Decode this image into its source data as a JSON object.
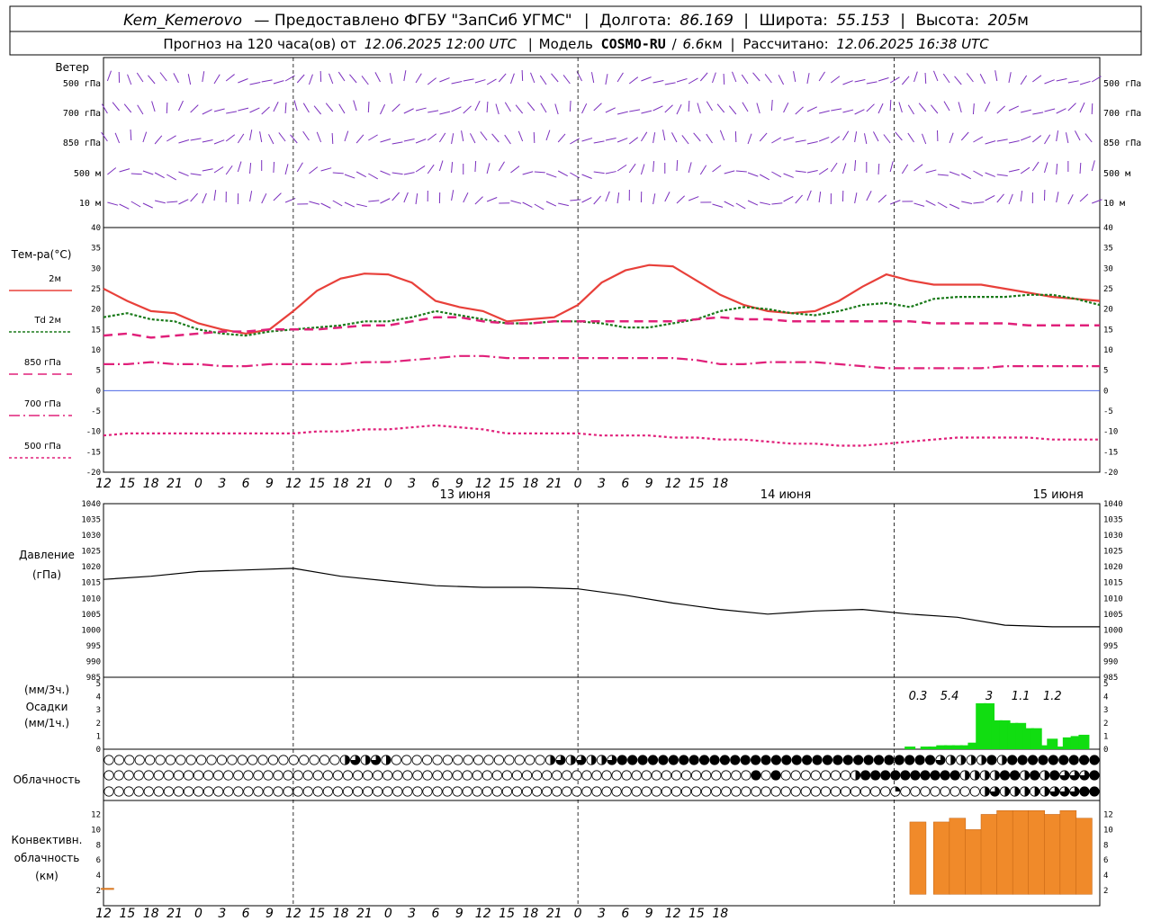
{
  "header": {
    "station": "Kem_Kemerovo",
    "provider": "— Предоставлено ФГБУ \"ЗапСиб УГМС\"",
    "lon_label": "Долгота:",
    "lon_value": "86.169",
    "lat_label": "Широта:",
    "lat_value": "55.153",
    "alt_label": "Высота:",
    "alt_value": "205",
    "alt_unit": "м",
    "forecast_label": "Прогноз на 120 часа(ов) от",
    "forecast_start": "12.06.2025 12:00 UTC",
    "model_label": "Модель",
    "model_name": "COSMO-RU",
    "model_res": "6.6",
    "model_res_unit": "км",
    "calc_label": "Рассчитано:",
    "calc_time": "12.06.2025 16:38 UTC"
  },
  "colors": {
    "wind": "#7b2fbe",
    "t2m": "#e8403a",
    "td2m": "#1a7a1a",
    "t850": "#e0207a",
    "zero_line": "#3050e0",
    "precip": "#11dd11",
    "convective": "#f08a2a"
  },
  "wind_panel": {
    "title": "Ветер",
    "levels": [
      "500 гПа",
      "700 гПа",
      "850 гПа",
      "500 м",
      "10  м"
    ]
  },
  "temp_panel": {
    "title": "Тем-ра(°C)",
    "legend": [
      {
        "label": "2м",
        "style": "solid"
      },
      {
        "label": "Td  2м",
        "style": "dotted"
      },
      {
        "label": "850 гПа",
        "style": "long-dash"
      },
      {
        "label": "700 гПа",
        "style": "dash-dot"
      },
      {
        "label": "500 гПа",
        "style": "dashed"
      }
    ],
    "yticks": [
      40,
      35,
      30,
      25,
      20,
      15,
      10,
      5,
      0,
      -5,
      -10,
      -15,
      -20
    ]
  },
  "time_axis": {
    "hours": [
      "12",
      "15",
      "18",
      "21",
      "0",
      "3",
      "6",
      "9",
      "12",
      "15",
      "18",
      "21",
      "0",
      "3",
      "6",
      "9",
      "12",
      "15",
      "18",
      "21",
      "0",
      "3",
      "6",
      "9",
      "12",
      "15",
      "18"
    ],
    "days": [
      "13 июня",
      "14 июня",
      "15 июня"
    ]
  },
  "pressure_panel": {
    "title": "Давление",
    "unit": "(гПа)",
    "yticks": [
      1040,
      1035,
      1030,
      1025,
      1020,
      1015,
      1010,
      1005,
      1000,
      995,
      990,
      985
    ]
  },
  "precip_panel": {
    "unit3": "(мм/3ч.)",
    "title": "Осадки",
    "unit1": "(мм/1ч.)",
    "yticks": [
      5,
      4,
      3,
      2,
      1,
      0
    ],
    "totals": [
      "0.3",
      "5.4",
      "3",
      "1.1",
      "1.2"
    ]
  },
  "cloud_panel": {
    "title": "Облачность"
  },
  "conv_panel": {
    "title1": "Конвективн.",
    "title2": "облачность",
    "unit": "(км)",
    "yticks": [
      12,
      10,
      8,
      6,
      4,
      2
    ]
  },
  "chart_data": [
    {
      "type": "line",
      "panel": "temperature",
      "ylim": [
        -20,
        40
      ],
      "x_hours": [
        0,
        3,
        6,
        9,
        12,
        15,
        18,
        21,
        24,
        27,
        30,
        33,
        36,
        39,
        42,
        45,
        48,
        51,
        54,
        57,
        60,
        63,
        66,
        69,
        72,
        75,
        78,
        81,
        84,
        87,
        90,
        93,
        96,
        99,
        102,
        105,
        108,
        111,
        114,
        117,
        120,
        123,
        126
      ],
      "series": [
        {
          "name": "2м",
          "values": [
            25,
            22,
            19.5,
            19,
            16.5,
            15,
            14,
            15,
            19.5,
            24.5,
            27.5,
            28.7,
            28.5,
            26.5,
            22,
            20.5,
            19.5,
            17,
            17.5,
            18,
            21,
            26.5,
            29.5,
            30.8,
            30.5,
            27,
            23.5,
            21,
            19.5,
            19,
            19.5,
            22,
            25.5,
            28.5,
            27,
            26,
            26,
            26,
            25,
            24,
            23,
            22.5,
            22
          ]
        },
        {
          "name": "Td  2м",
          "values": [
            18,
            19,
            17.5,
            17,
            15,
            14,
            13.5,
            14.5,
            15,
            15.5,
            16,
            17,
            17,
            18,
            19.5,
            18.5,
            17.5,
            16.5,
            16.5,
            17,
            17,
            16.5,
            15.5,
            15.5,
            16.5,
            17.5,
            19.5,
            20.5,
            20,
            19,
            18.5,
            19.5,
            21,
            21.5,
            20.5,
            22.5,
            23,
            23,
            23,
            23.5,
            23.5,
            22.5,
            21
          ]
        },
        {
          "name": "850 гПа",
          "values": [
            13.5,
            14,
            13,
            13.5,
            14,
            14.5,
            14.5,
            15,
            15,
            15,
            15.5,
            16,
            16,
            17,
            18,
            18,
            17,
            16.5,
            16.5,
            17,
            17,
            17,
            17,
            17,
            17,
            17.5,
            18,
            17.5,
            17.5,
            17,
            17,
            17,
            17,
            17,
            17,
            16.5,
            16.5,
            16.5,
            16.5,
            16,
            16,
            16,
            16
          ]
        },
        {
          "name": "700 гПа",
          "values": [
            6.5,
            6.5,
            7,
            6.5,
            6.5,
            6,
            6,
            6.5,
            6.5,
            6.5,
            6.5,
            7,
            7,
            7.5,
            8,
            8.5,
            8.5,
            8,
            8,
            8,
            8,
            8,
            8,
            8,
            8,
            7.5,
            6.5,
            6.5,
            7,
            7,
            7,
            6.5,
            6,
            5.5,
            5.5,
            5.5,
            5.5,
            5.5,
            6,
            6,
            6,
            6,
            6
          ]
        },
        {
          "name": "500 гПа",
          "values": [
            -11,
            -10.5,
            -10.5,
            -10.5,
            -10.5,
            -10.5,
            -10.5,
            -10.5,
            -10.5,
            -10,
            -10,
            -9.5,
            -9.5,
            -9,
            -8.5,
            -9,
            -9.5,
            -10.5,
            -10.5,
            -10.5,
            -10.5,
            -11,
            -11,
            -11,
            -11.5,
            -11.5,
            -12,
            -12,
            -12.5,
            -13,
            -13,
            -13.5,
            -13.5,
            -13,
            -12.5,
            -12,
            -11.5,
            -11.5,
            -11.5,
            -11.5,
            -12,
            -12,
            -12
          ]
        }
      ]
    },
    {
      "type": "line",
      "panel": "pressure",
      "ylim": [
        985,
        1040
      ],
      "x_hours": [
        0,
        6,
        12,
        18,
        24,
        30,
        36,
        42,
        48,
        54,
        60,
        66,
        72,
        78,
        84,
        90,
        96,
        102,
        108,
        114,
        120,
        126
      ],
      "series": [
        {
          "name": "Давление",
          "values": [
            1016,
            1017,
            1018.5,
            1019,
            1019.5,
            1017,
            1015.5,
            1014,
            1013.5,
            1013.5,
            1013,
            1011,
            1008.5,
            1006.5,
            1005,
            1006,
            1006.5,
            1005,
            1004,
            1001.5,
            1001,
            1001
          ]
        }
      ]
    },
    {
      "type": "bar",
      "panel": "precipitation",
      "ylim": [
        0,
        5
      ],
      "x_hours": [
        102,
        104,
        105,
        106,
        107,
        108,
        109,
        110,
        111,
        112,
        113,
        114,
        115,
        116,
        117,
        118,
        119,
        120,
        121,
        122,
        123,
        124
      ],
      "values": [
        0.2,
        0.2,
        0.2,
        0.3,
        0.3,
        0.3,
        0.3,
        0.5,
        3.5,
        3.5,
        2.2,
        2.2,
        2,
        2,
        1.6,
        1.6,
        0.3,
        0.8,
        0.2,
        0.9,
        1,
        1.1
      ]
    },
    {
      "type": "bar",
      "panel": "convective",
      "ylim": [
        0,
        13
      ],
      "bars": [
        {
          "x": 0.5,
          "base": 2.2,
          "top": 2.3
        },
        {
          "x": 103,
          "base": 1.5,
          "top": 11
        },
        {
          "x": 106,
          "base": 1.5,
          "top": 11
        },
        {
          "x": 108,
          "base": 1.5,
          "top": 11.5
        },
        {
          "x": 110,
          "base": 1.5,
          "top": 10
        },
        {
          "x": 112,
          "base": 1.5,
          "top": 12
        },
        {
          "x": 114,
          "base": 1.5,
          "top": 12.5
        },
        {
          "x": 116,
          "base": 1.5,
          "top": 12.5
        },
        {
          "x": 118,
          "base": 1.5,
          "top": 12.5
        },
        {
          "x": 120,
          "base": 1.5,
          "top": 12
        },
        {
          "x": 122,
          "base": 1.5,
          "top": 12.5
        },
        {
          "x": 124,
          "base": 1.5,
          "top": 11.5
        }
      ]
    },
    {
      "type": "heatmap",
      "panel": "cloudiness",
      "rows": 3,
      "note_values": "cover fraction 0..1 per step (upper, middle, lower)",
      "upper": [
        0,
        0,
        0,
        0,
        0,
        0,
        0,
        0,
        0,
        0,
        0,
        0,
        0,
        0,
        0,
        0,
        0,
        0,
        0,
        0,
        0,
        0,
        0,
        0.5,
        0.75,
        0.5,
        0.75,
        0.5,
        0,
        0,
        0,
        0,
        0,
        0,
        0,
        0,
        0,
        0,
        0,
        0,
        0,
        0,
        0,
        0.5,
        0.75,
        0.5,
        0.75,
        0.5,
        0.5,
        0.75,
        1,
        1,
        1,
        1,
        1,
        1,
        1,
        1,
        1,
        1,
        1,
        1,
        1,
        1,
        1,
        1,
        1,
        1,
        1,
        1,
        1,
        1,
        1,
        1,
        1,
        1,
        1,
        1,
        1,
        1,
        1,
        0.75,
        0.5,
        0.5,
        0.5,
        0.5,
        1,
        0.5,
        1,
        1,
        1,
        1,
        1,
        1,
        1,
        1,
        1
      ],
      "middle": [
        0,
        0,
        0,
        0,
        0,
        0,
        0,
        0,
        0,
        0,
        0,
        0,
        0,
        0,
        0,
        0,
        0,
        0,
        0,
        0,
        0,
        0,
        0,
        0,
        0,
        0,
        0,
        0,
        0,
        0,
        0,
        0,
        0,
        0,
        0,
        0,
        0,
        0,
        0,
        0,
        0,
        0,
        0,
        0,
        0,
        0,
        0,
        0,
        0,
        0,
        0,
        0,
        0,
        0,
        0,
        0,
        0,
        0,
        0,
        0,
        0,
        0,
        0,
        0,
        0,
        1,
        0,
        1,
        0,
        0,
        0,
        0,
        0,
        0,
        0,
        0.5,
        1,
        1,
        1,
        1,
        1,
        1,
        1,
        1,
        1,
        1,
        0.5,
        0.5,
        0.5,
        0.5,
        1,
        1,
        0.5,
        1,
        0.5,
        1,
        0.75,
        0.75,
        0.75,
        1
      ],
      "lower": [
        0,
        0,
        0,
        0,
        0,
        0,
        0,
        0,
        0,
        0,
        0,
        0,
        0,
        0,
        0,
        0,
        0,
        0,
        0,
        0,
        0,
        0,
        0,
        0,
        0,
        0,
        0,
        0,
        0,
        0,
        0,
        0,
        0,
        0,
        0,
        0,
        0,
        0,
        0,
        0,
        0,
        0,
        0,
        0,
        0,
        0,
        0,
        0,
        0,
        0,
        0,
        0,
        0,
        0,
        0,
        0,
        0,
        0,
        0,
        0,
        0,
        0,
        0,
        0,
        0,
        0,
        0,
        0,
        0,
        0,
        0,
        0,
        0,
        0,
        0,
        0,
        0,
        0,
        0,
        0.25,
        0,
        0,
        0,
        0,
        0,
        0,
        0,
        0,
        0.5,
        0.75,
        0.5,
        0.5,
        0.5,
        0.5,
        0.5,
        0.75,
        0.75,
        0.75,
        1,
        1
      ]
    }
  ]
}
